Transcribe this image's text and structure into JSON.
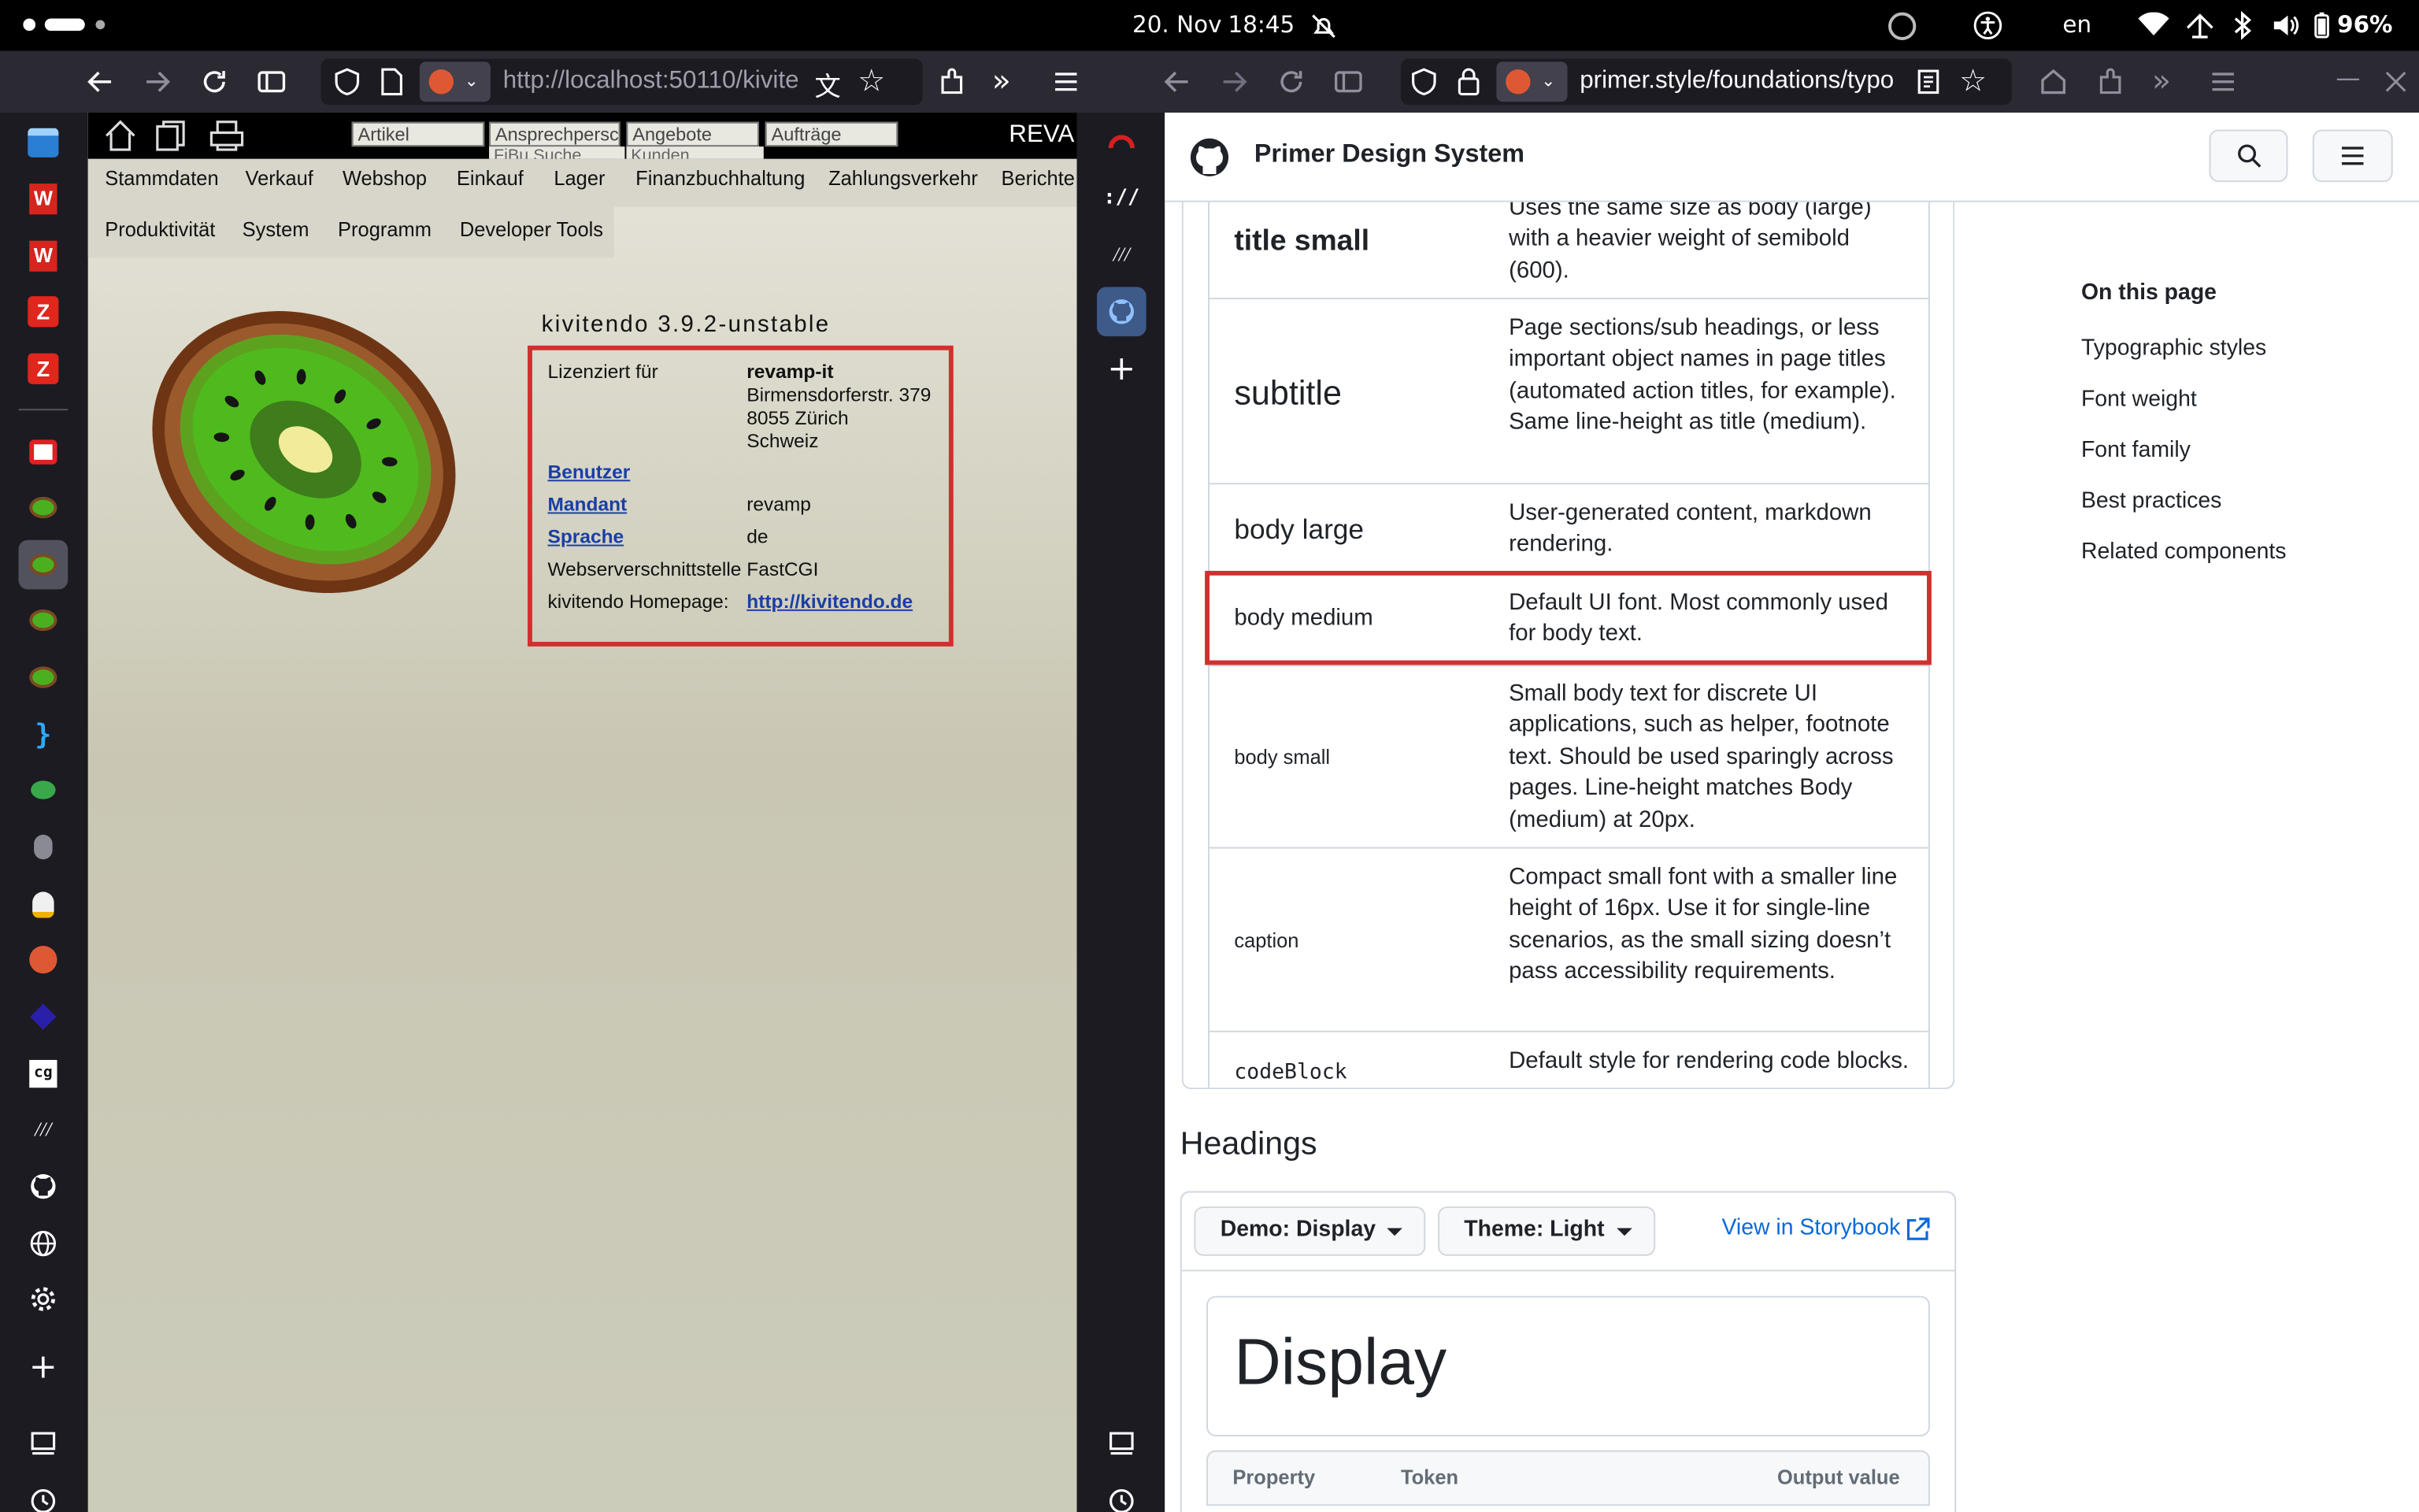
{
  "system_bar": {
    "date": "20. Nov",
    "time": "18:45",
    "language": "en",
    "battery": "96%"
  },
  "left_browser": {
    "url": "http://localhost:50110/kivite",
    "sidebar_icons": [
      "calendar-icon",
      "w-icon",
      "w-icon",
      "z-icon",
      "z-icon",
      "chat-icon",
      "kiwi-icon",
      "kiwi-icon",
      "kiwi-icon",
      "kiwi-icon",
      "braces-icon",
      "bug-icon",
      "mouse-icon",
      "tux-icon",
      "duckduckgo-icon",
      "dot-icon",
      "code-icon",
      "m-icon",
      "github-icon",
      "globe-icon",
      "gear-icon",
      "plus-icon"
    ]
  },
  "kivitendo": {
    "quicksearch": {
      "artikel": "Artikel",
      "ansprech": "Ansprechpersc",
      "ansprech_sub": "FiBu Suche",
      "angebote": "Angebote",
      "angebote_sub": "Kunden",
      "auftraege": "Aufträge"
    },
    "brand": "REVA",
    "menu_row1": [
      "Stammdaten",
      "Verkauf",
      "Webshop",
      "Einkauf",
      "Lager",
      "Finanzbuchhaltung",
      "Zahlungsverkehr",
      "Berichte"
    ],
    "menu_row2": [
      "Produktivität",
      "System",
      "Programm",
      "Developer Tools"
    ],
    "version": "kivitendo 3.9.2-unstable",
    "info": {
      "licensed_label": "Lizenziert für",
      "company": "revamp-it",
      "street": "Birmensdorferstr. 379",
      "city": "8055 Zürich",
      "country": "Schweiz",
      "benutzer": "Benutzer",
      "mandant_label": "Mandant",
      "mandant_value": "revamp",
      "sprache_label": "Sprache",
      "sprache_value": "de",
      "webserver_label": "Webserverschnittstelle",
      "webserver_value": "FastCGI",
      "homepage_label": "kivitendo Homepage:",
      "homepage_value": "http://kivitendo.de"
    },
    "highlight_color": "#d32f2f"
  },
  "right_browser": {
    "url": "primer.style/foundations/typo"
  },
  "primer": {
    "site_title": "Primer Design System",
    "rows": [
      {
        "name": "title small",
        "desc": "Uses the same size as body (large) with a heavier weight of semibold (600)."
      },
      {
        "name": "subtitle",
        "desc": "Page sections/sub headings, or less important object names in page titles (automated action titles, for example). Same line-height as title (medium)."
      },
      {
        "name": "body large",
        "desc": "User-generated content, markdown rendering."
      },
      {
        "name": "body medium",
        "desc": "Default UI font. Most commonly used for body text."
      },
      {
        "name": "body small",
        "desc": "Small body text for discrete UI applications, such as helper, footnote text. Should be used sparingly across pages. Line-height matches Body (medium) at 20px."
      },
      {
        "name": "caption",
        "desc": "Compact small font with a smaller line height of 16px. Use it for single-line scenarios, as the small sizing doesn’t pass accessibility requirements."
      },
      {
        "name": "codeBlock",
        "desc": "Default style for rendering code blocks."
      }
    ],
    "toc_title": "On this page",
    "toc": [
      "Typographic styles",
      "Font weight",
      "Font family",
      "Best practices",
      "Related components"
    ],
    "headings_title": "Headings",
    "demo_button": "Demo: Display",
    "theme_button": "Theme: Light",
    "storybook_link": "View in Storybook",
    "display_sample": "Display",
    "table_headers": [
      "Property",
      "Token",
      "Output value"
    ],
    "link_color": "#0969da"
  }
}
